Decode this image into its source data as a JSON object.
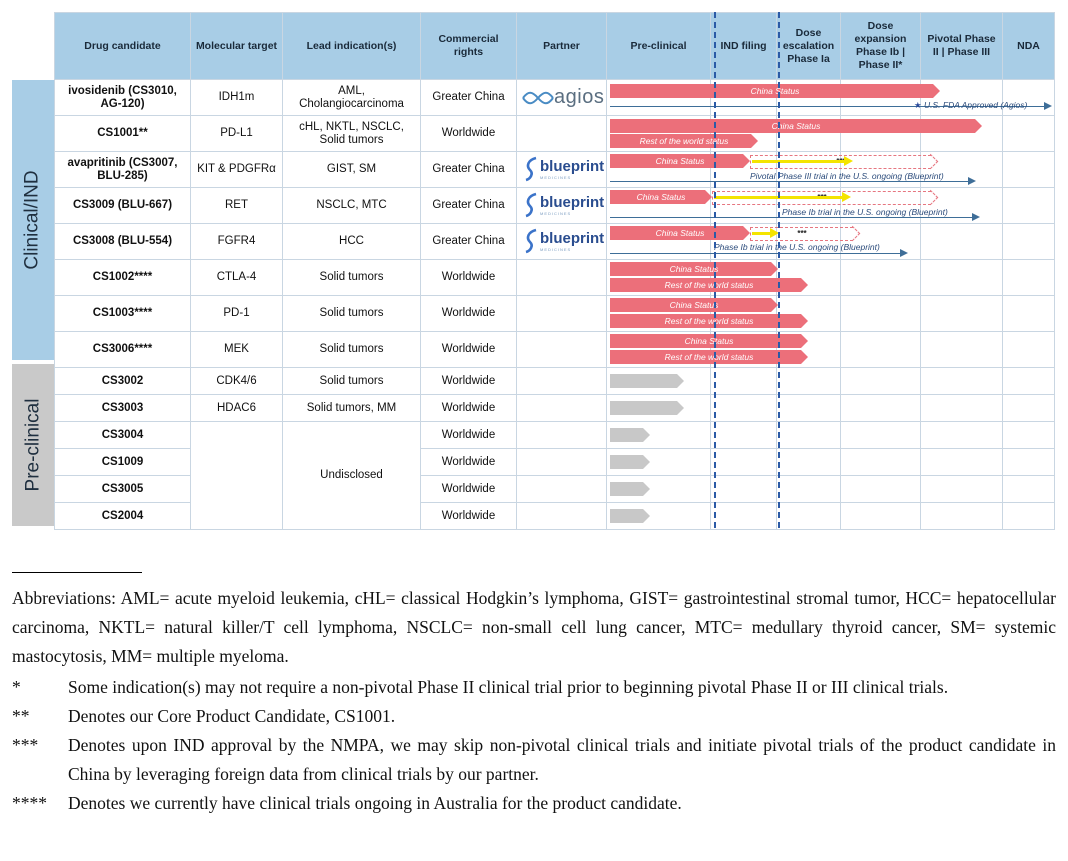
{
  "headers": {
    "drug": "Drug candidate",
    "target": "Molecular target",
    "indication": "Lead indication(s)",
    "rights": "Commercial rights",
    "partner": "Partner",
    "preclinical": "Pre-clinical",
    "ind": "IND filing",
    "dose_esc": "Dose escalation Phase Ia",
    "dose_exp": "Dose expansion Phase Ib | Phase II*",
    "pivotal": "Pivotal Phase II | Phase III",
    "nda": "NDA"
  },
  "groups": {
    "clinical": "Clinical/IND",
    "preclinical": "Pre-clinical"
  },
  "rows": [
    {
      "drug": "ivosidenib (CS3010, AG-120)",
      "target": "IDH1m",
      "indication": "AML, Cholangiocarcinoma",
      "rights": "Greater China",
      "partner": "agios"
    },
    {
      "drug": "CS1001**",
      "target": "PD-L1",
      "indication": "cHL, NKTL, NSCLC, Solid tumors",
      "rights": "Worldwide",
      "partner": ""
    },
    {
      "drug": "avapritinib (CS3007, BLU-285)",
      "target": "KIT & PDGFRα",
      "indication": "GIST, SM",
      "rights": "Greater China",
      "partner": "blueprint"
    },
    {
      "drug": "CS3009 (BLU-667)",
      "target": "RET",
      "indication": "NSCLC, MTC",
      "rights": "Greater China",
      "partner": "blueprint"
    },
    {
      "drug": "CS3008 (BLU-554)",
      "target": "FGFR4",
      "indication": "HCC",
      "rights": "Greater China",
      "partner": "blueprint"
    },
    {
      "drug": "CS1002****",
      "target": "CTLA-4",
      "indication": "Solid tumors",
      "rights": "Worldwide",
      "partner": ""
    },
    {
      "drug": "CS1003****",
      "target": "PD-1",
      "indication": "Solid tumors",
      "rights": "Worldwide",
      "partner": ""
    },
    {
      "drug": "CS3006****",
      "target": "MEK",
      "indication": "Solid tumors",
      "rights": "Worldwide",
      "partner": ""
    },
    {
      "drug": "CS3002",
      "target": "CDK4/6",
      "indication": "Solid tumors",
      "rights": "Worldwide",
      "partner": ""
    },
    {
      "drug": "CS3003",
      "target": "HDAC6",
      "indication": "Solid tumors, MM",
      "rights": "Worldwide",
      "partner": ""
    },
    {
      "drug": "CS3004",
      "target": "",
      "indication": "Undisclosed",
      "rights": "Worldwide",
      "partner": ""
    },
    {
      "drug": "CS1009",
      "target": "",
      "indication": "",
      "rights": "Worldwide",
      "partner": ""
    },
    {
      "drug": "CS3005",
      "target": "",
      "indication": "",
      "rights": "Worldwide",
      "partner": ""
    },
    {
      "drug": "CS2004",
      "target": "",
      "indication": "",
      "rights": "Worldwide",
      "partner": ""
    }
  ],
  "bar_labels": {
    "china": "China Status",
    "row": "Rest of the world status",
    "fda": "U.S. FDA Approved (Agios)",
    "star": "★",
    "triple": "***",
    "blu285": "Pivotal Phase III trial in the U.S. ongoing (Blueprint)",
    "blu667": "Phase Ib trial in the U.S. ongoing (Blueprint)",
    "blu554": "Phase Ib trial in the U.S. ongoing (Blueprint)"
  },
  "logos": {
    "agios": "agios",
    "blueprint": "blueprint",
    "blueprint_sub": "MEDICINES"
  },
  "colors": {
    "header_bg": "#a8cde6",
    "clinical_band": "#a8cde6",
    "preclinical_band": "#c9c9c9",
    "bar_red": "#ec6f7a",
    "bar_grey": "#c8c8c8",
    "arrow_yellow": "#f4e400",
    "milestone_blue": "#2b5aa6"
  },
  "notes": {
    "abbreviations": "Abbreviations: AML= acute myeloid leukemia, cHL= classical Hodgkin’s lymphoma, GIST= gastrointestinal stromal tumor, HCC= hepatocellular carcinoma, NKTL= natural killer/T cell lymphoma, NSCLC= non-small cell lung cancer, MTC= medullary thyroid cancer, SM= systemic mastocytosis, MM= multiple myeloma.",
    "footnotes": [
      {
        "marker": "*",
        "text": "Some indication(s) may not require a non-pivotal Phase II clinical trial prior to beginning pivotal Phase II or III clinical trials."
      },
      {
        "marker": "**",
        "text": "Denotes our Core Product Candidate, CS1001."
      },
      {
        "marker": "***",
        "text": "Denotes upon IND approval by the NMPA, we may skip non-pivotal clinical trials and initiate pivotal trials of the product candidate in China by leveraging foreign data from clinical trials by our partner."
      },
      {
        "marker": "****",
        "text": "Denotes we currently have clinical trials ongoing in Australia for the product candidate."
      }
    ]
  }
}
